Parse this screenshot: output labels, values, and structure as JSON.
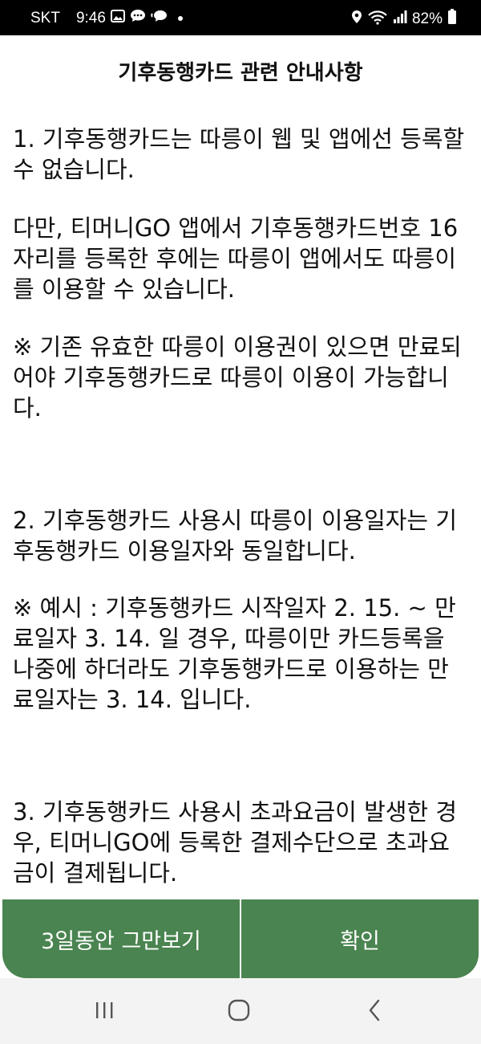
{
  "status_bar": {
    "carrier": "SKT",
    "time": "9:46",
    "battery": "82%"
  },
  "dialog": {
    "title": "기후동행카드 관련 안내사항",
    "paragraphs": [
      "1. 기후동행카드는 따릉이 웹 및 앱에선 등록할 수 없습니다.",
      "다만, 티머니GO 앱에서 기후동행카드번호 16자리를 등록한 후에는 따릉이 앱에서도 따릉이를 이용할 수 있습니다.",
      "※ 기존 유효한 따릉이 이용권이 있으면 만료되어야 기후동행카드로 따릉이 이용이 가능합니다.",
      "2. 기후동행카드 사용시 따릉이 이용일자는 기후동행카드 이용일자와 동일합니다.",
      "※ 예시 : 기후동행카드 시작일자 2. 15. ~ 만료일자 3. 14. 일 경우, 따릉이만 카드등록을 나중에 하더라도 기후동행카드로 이용하는 만료일자는 3. 14. 입니다.",
      "3. 기후동행카드 사용시 초과요금이 발생한 경우, 티머니GO에 등록한 결제수단으로 초과요금이 결제됩니다."
    ]
  },
  "buttons": {
    "dismiss_3days": "3일동안 그만보기",
    "confirm": "확인"
  },
  "colors": {
    "button_bg": "#4a8450",
    "status_bar_bg": "#000000",
    "nav_bar_bg": "#f3f3f3"
  },
  "icons": {
    "status_left": [
      "gallery-icon",
      "chat-icon",
      "talk-icon",
      "dot-icon"
    ],
    "status_right": [
      "location-icon",
      "wifi-icon",
      "signal-icon",
      "battery-icon"
    ],
    "nav": [
      "recent-apps-icon",
      "home-icon",
      "back-icon"
    ]
  }
}
